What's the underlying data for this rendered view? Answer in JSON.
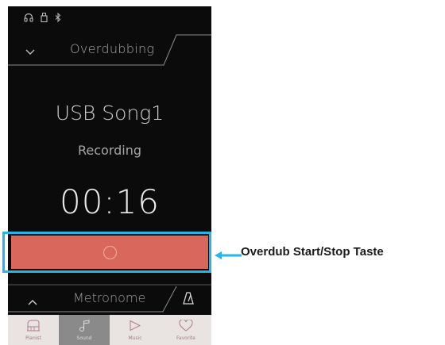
{
  "status_icons": [
    "headphones-icon",
    "usb-icon",
    "bluetooth-icon"
  ],
  "header": {
    "title": "Overdubbing"
  },
  "song": {
    "name": "USB Song1",
    "status": "Recording",
    "time": "00:16"
  },
  "overdub_button": {
    "icon": "record-circle-icon",
    "color": "#d9675b"
  },
  "metronome": {
    "label": "Metronome"
  },
  "nav": {
    "items": [
      {
        "label": "Pianist",
        "icon": "piano-icon",
        "active": false
      },
      {
        "label": "Sound",
        "icon": "music-note-icon",
        "active": true
      },
      {
        "label": "Music",
        "icon": "play-icon",
        "active": false
      },
      {
        "label": "Favorite",
        "icon": "heart-icon",
        "active": false
      }
    ]
  },
  "callout": {
    "text": "Overdub Start/Stop Taste",
    "color": "#27b5e8"
  }
}
